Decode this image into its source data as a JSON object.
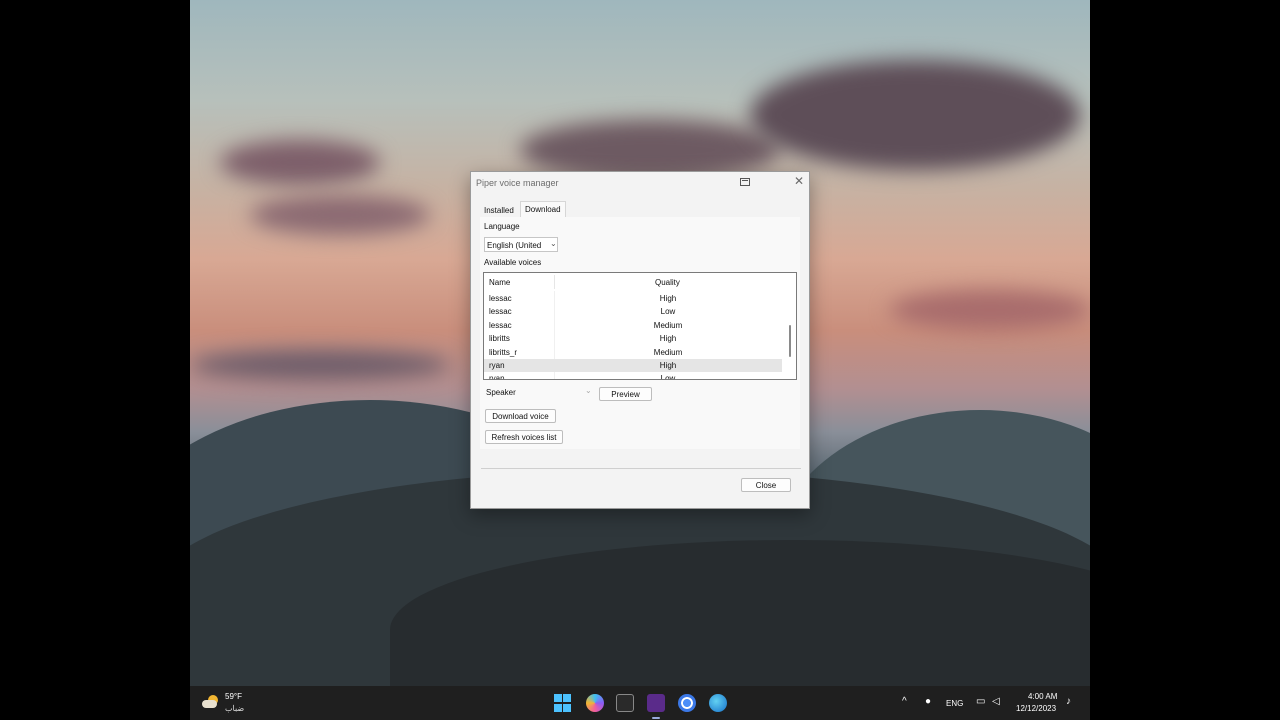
{
  "window": {
    "title": "Piper voice manager",
    "close_glyph": "✕"
  },
  "tabs": [
    {
      "label": "Installed"
    },
    {
      "label": "Download"
    }
  ],
  "language": {
    "label": "Language",
    "selected": "English (United",
    "chevron": "⌄"
  },
  "voices": {
    "label": "Available voices",
    "columns": [
      "Name",
      "Quality"
    ],
    "rows": [
      {
        "name": "lessac",
        "quality": "High"
      },
      {
        "name": "lessac",
        "quality": "Low"
      },
      {
        "name": "lessac",
        "quality": "Medium"
      },
      {
        "name": "libritts",
        "quality": "High"
      },
      {
        "name": "libritts_r",
        "quality": "Medium"
      },
      {
        "name": "ryan",
        "quality": "High"
      },
      {
        "name": "ryan",
        "quality": "Low"
      }
    ],
    "selected_row": 5
  },
  "speaker": {
    "placeholder": "Speaker",
    "chevron": "⌄"
  },
  "buttons": {
    "preview": "Preview",
    "download_voice": "Download voice",
    "refresh": "Refresh voices list",
    "close": "Close"
  },
  "taskbar": {
    "weather_temp": "59°F",
    "weather_desc": "ضباب",
    "language": "ENG",
    "time": "4:00 AM",
    "date": "12/12/2023",
    "chevron_up": "^",
    "icons": [
      "windows-start-icon",
      "copilot-icon",
      "terminal-icon",
      "nvda-icon",
      "chrome-icon",
      "edge-icon"
    ]
  }
}
